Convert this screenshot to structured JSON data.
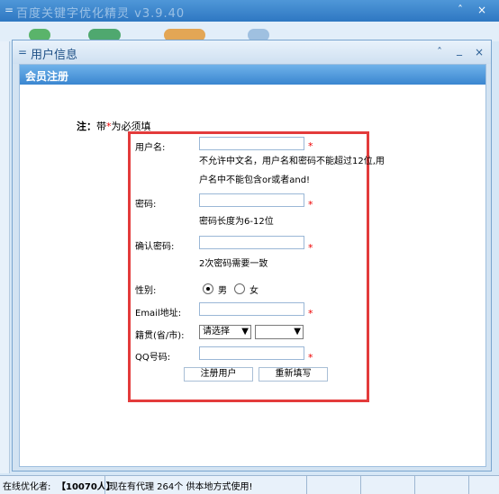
{
  "background_window": {
    "title": "百度关键字优化精灵 v3.9.40",
    "minimize": "ˆ",
    "close": "×"
  },
  "dialog": {
    "title": "用户信息",
    "minimize": "ˆ",
    "restore": "_",
    "close": "×"
  },
  "panel": {
    "header": "会员注册"
  },
  "note": {
    "prefix": "注：",
    "text1": "带",
    "star": "*",
    "text2": "为必须填"
  },
  "form": {
    "username": {
      "label": "用户名:",
      "value": "",
      "hint_line1": "不允许中文名，用户名和密码不能超过12位,用",
      "hint_line2": "户名中不能包含or或者and!"
    },
    "password": {
      "label": "密码:",
      "value": "",
      "hint": "密码长度为6-12位"
    },
    "confirm_password": {
      "label": "确认密码:",
      "value": "",
      "hint": "2次密码需要一致"
    },
    "gender": {
      "label": "性别:",
      "options": [
        "男",
        "女"
      ],
      "selected": "男"
    },
    "email": {
      "label": "Email地址:",
      "value": ""
    },
    "region": {
      "label": "籍贯(省/市):",
      "province_value": "请选择",
      "city_value": ""
    },
    "qq": {
      "label": "QQ号码:",
      "value": ""
    },
    "required_star": "*",
    "submit_label": "注册用户",
    "reset_label": "重新填写"
  },
  "status_bar": {
    "online_label": "在线优化者:",
    "online_count": "【10070人】",
    "proxy_text": "现在有代理 264个 供本地方式使用!"
  },
  "colors": {
    "highlight_frame": "#e33b3b",
    "panel_header": "#3a86d0",
    "required": "#ee0000"
  }
}
